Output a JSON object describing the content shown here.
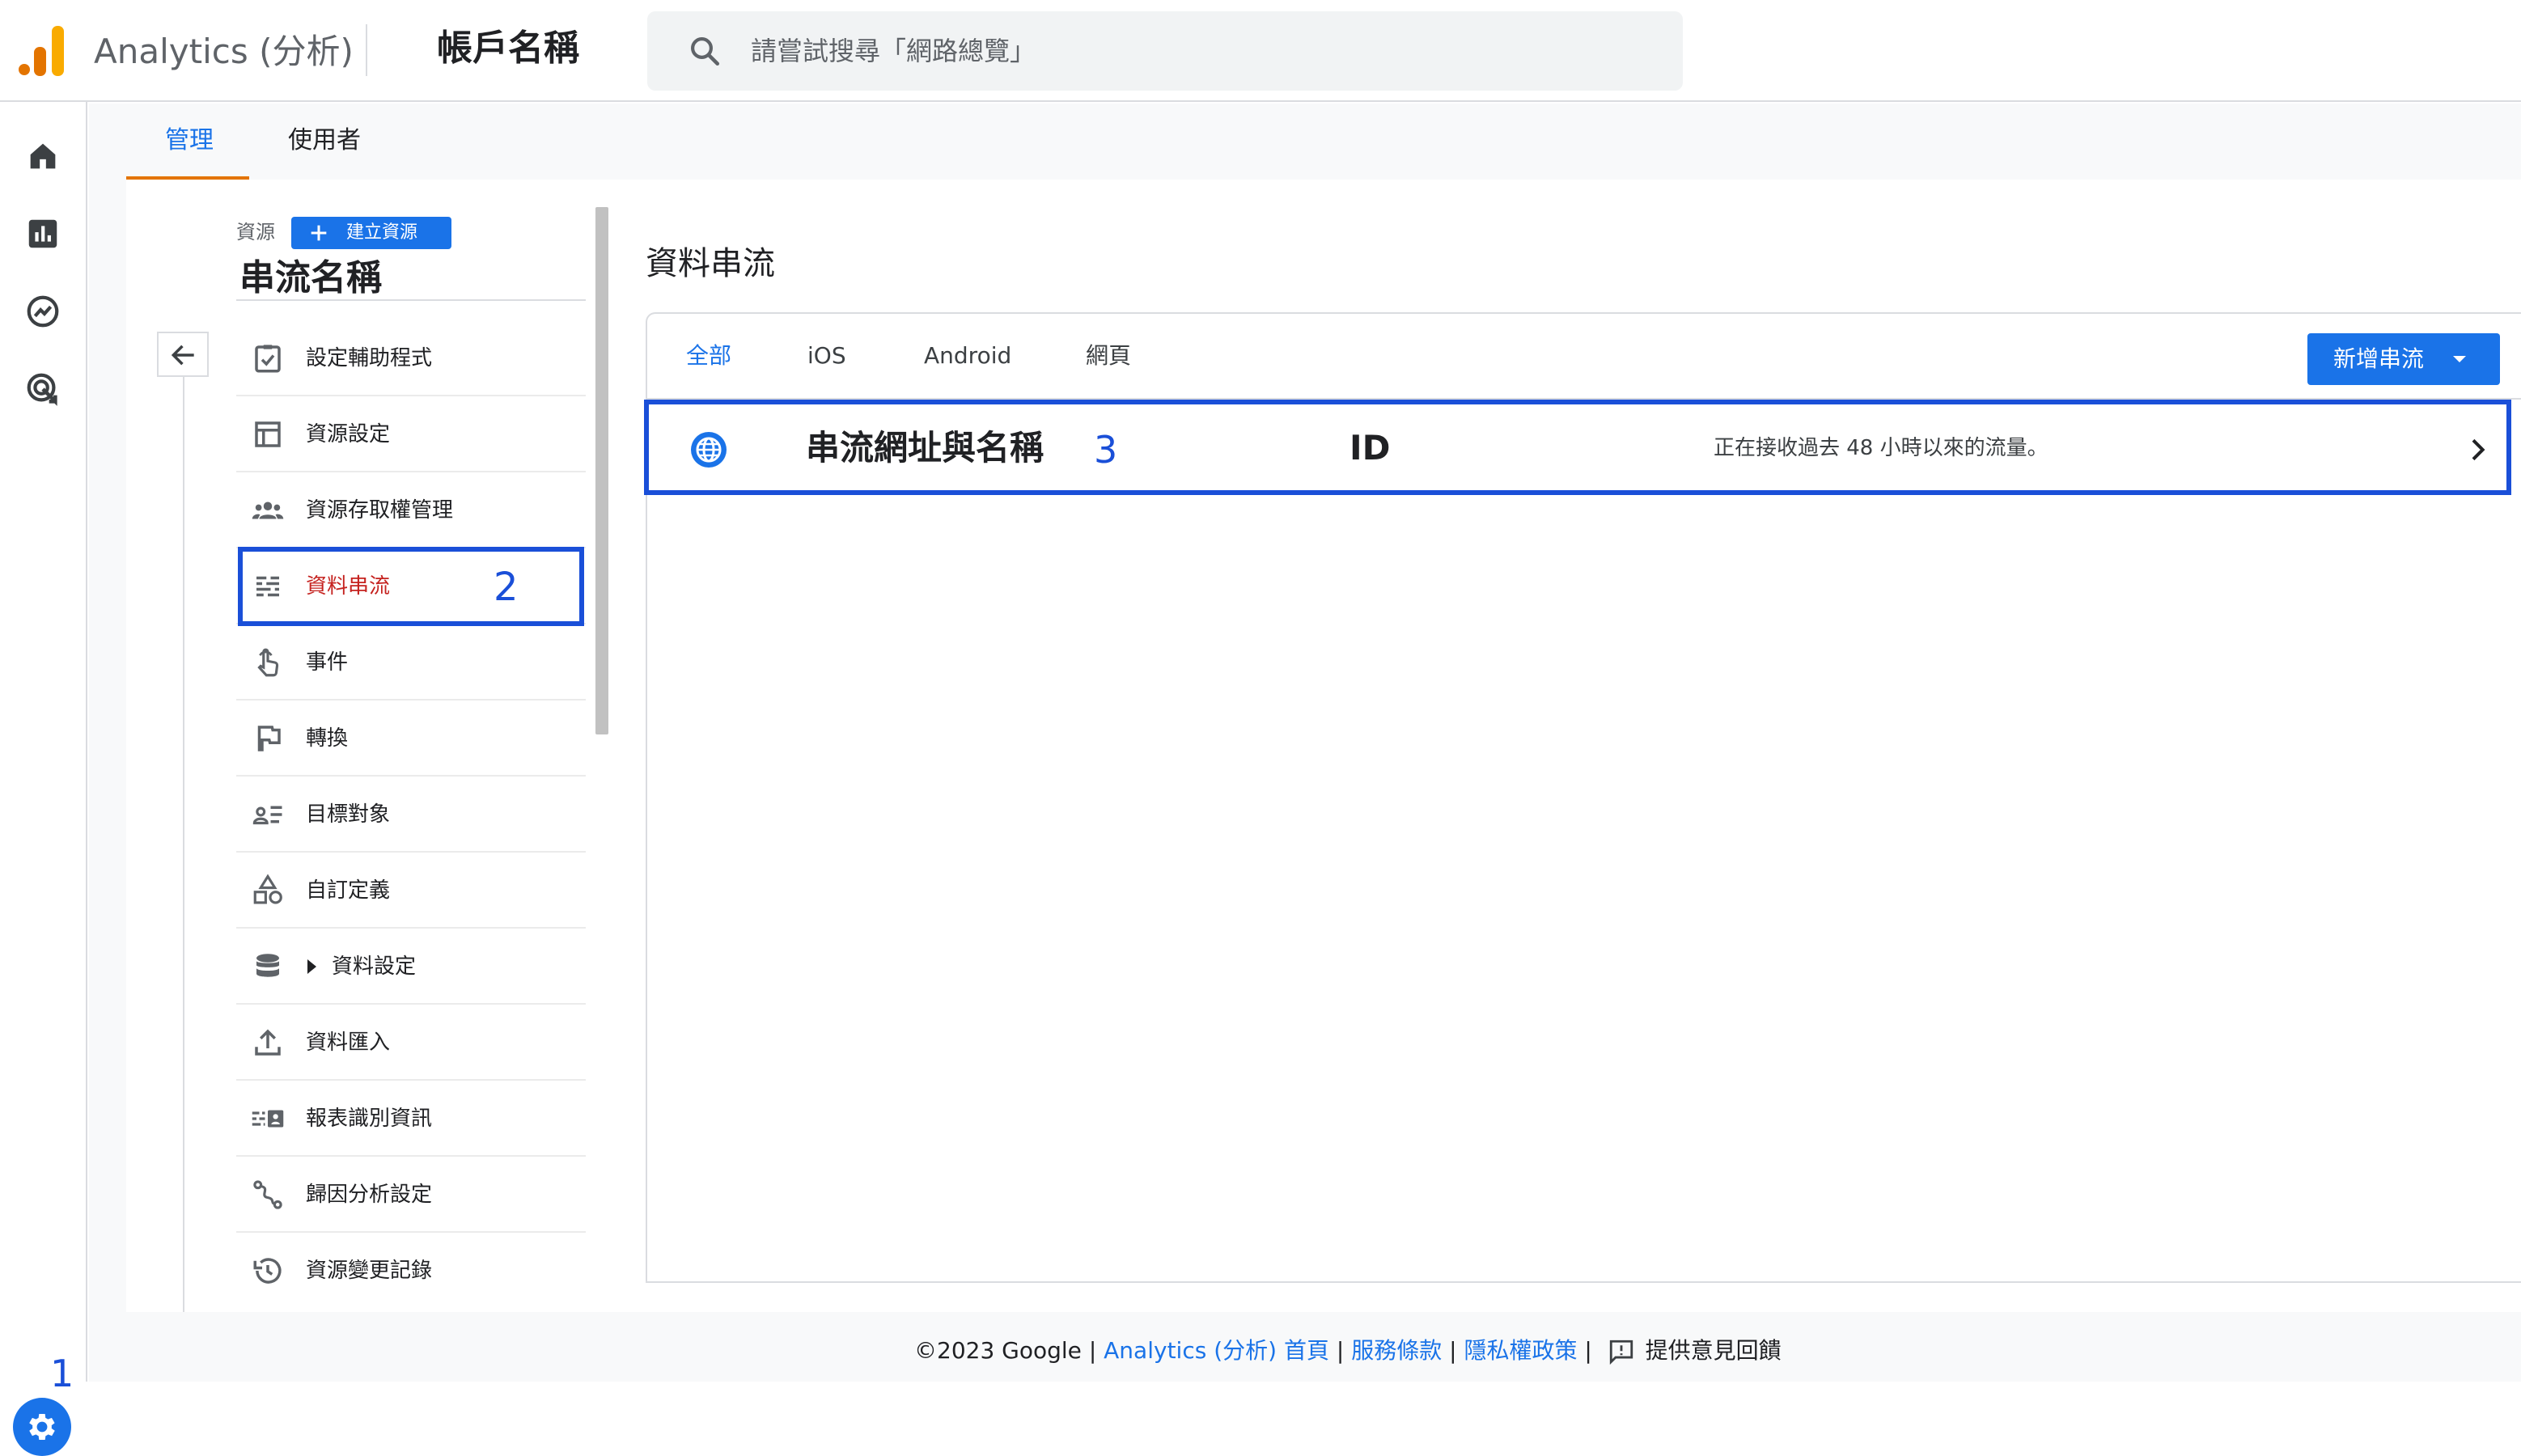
{
  "header": {
    "product_name": "Analytics (分析)",
    "account_name": "帳戶名稱",
    "search_placeholder": "請嘗試搜尋「網路總覽」"
  },
  "rail": {
    "badge": "1",
    "icons": [
      "home-icon",
      "reports-icon",
      "explore-icon",
      "advertising-icon",
      "gear-icon"
    ]
  },
  "tabs": {
    "admin": "管理",
    "users": "使用者"
  },
  "property": {
    "section_label": "資源",
    "create_button": "建立資源",
    "stream_name": "串流名稱"
  },
  "nav": {
    "items": [
      {
        "label": "設定輔助程式",
        "icon": "checklist-icon"
      },
      {
        "label": "資源設定",
        "icon": "property-settings-icon"
      },
      {
        "label": "資源存取權管理",
        "icon": "people-icon"
      },
      {
        "label": "資料串流",
        "icon": "data-streams-icon"
      },
      {
        "label": "事件",
        "icon": "touch-icon"
      },
      {
        "label": "轉換",
        "icon": "flag-icon"
      },
      {
        "label": "目標對象",
        "icon": "audience-icon"
      },
      {
        "label": "自訂定義",
        "icon": "shapes-icon"
      },
      {
        "label": "資料設定",
        "icon": "database-icon"
      },
      {
        "label": "資料匯入",
        "icon": "upload-icon"
      },
      {
        "label": "報表識別資訊",
        "icon": "reporting-identity-icon"
      },
      {
        "label": "歸因分析設定",
        "icon": "attribution-icon"
      },
      {
        "label": "資源變更記錄",
        "icon": "history-icon"
      }
    ],
    "highlight_label": "2"
  },
  "panel": {
    "title": "資料串流",
    "filter_tabs": [
      "全部",
      "iOS",
      "Android",
      "網頁"
    ],
    "add_stream_button": "新增串流",
    "stream": {
      "name": "串流網址與名稱",
      "highlight_label": "3",
      "id": "ID",
      "status": "正在接收過去 48 小時以來的流量。"
    }
  },
  "footer": {
    "copyright": "©2023 Google",
    "links": [
      "Analytics (分析) 首頁",
      "服務條款",
      "隱私權政策"
    ],
    "feedback": "提供意見回饋"
  },
  "colors": {
    "accent": "#1a73e8",
    "highlight": "#1a4fd8",
    "active_nav": "#c5221f",
    "tab_underline": "#e37400"
  }
}
